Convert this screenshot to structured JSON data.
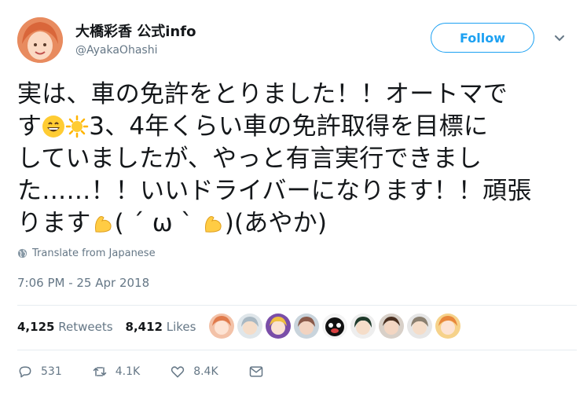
{
  "author": {
    "display_name": "大橋彩香 公式info",
    "handle": "@AyakaOhashi"
  },
  "follow_label": "Follow",
  "tweet": {
    "lines": [
      "実は、車の免許をとりました！！オートマで",
      "3、4年くらい車の免許取得を目標に",
      "していましたが、やっと有言実行できまし",
      "た……！！いいドライバーになります！！頑張",
      "ります",
      "( ˊ ω ˋ ",
      ")(あやか)"
    ],
    "line2_prefix": "す"
  },
  "translate_label": "Translate from Japanese",
  "timestamp": "7:06 PM - 25 Apr 2018",
  "stats": {
    "retweets_count": "4,125",
    "retweets_label": "Retweets",
    "likes_count": "8,412",
    "likes_label": "Likes"
  },
  "actions": {
    "replies": "531",
    "retweets": "4.1K",
    "likes": "8.4K"
  },
  "icons": [
    "grinning-emoji-icon",
    "sun-emoji-icon",
    "flexed-biceps-emoji-icon",
    "globe-icon",
    "reply-icon",
    "retweet-icon",
    "like-icon",
    "message-icon",
    "caret-down-icon"
  ],
  "colors": {
    "accent": "#1da1f2",
    "muted": "#657786",
    "text": "#14171a"
  }
}
